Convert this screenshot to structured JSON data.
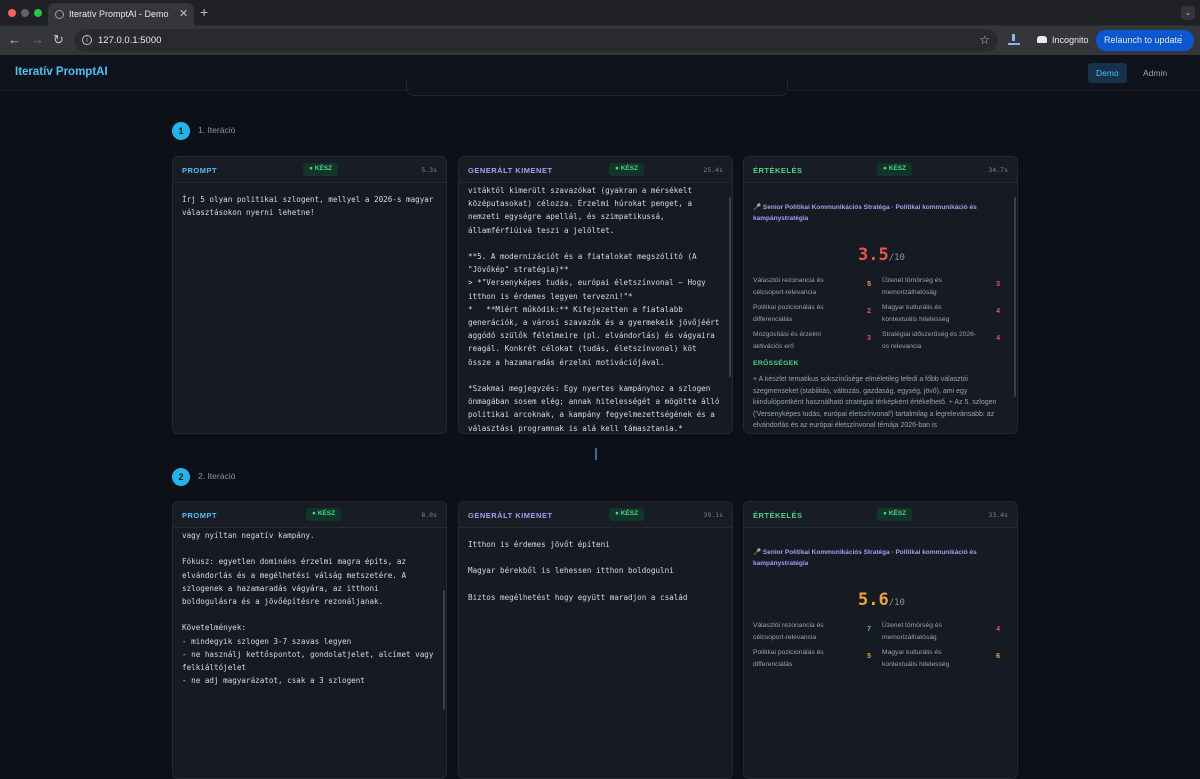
{
  "browser": {
    "tab_title": "Iteratív PromptAI - Demo",
    "url": "127.0.0.1:5000",
    "incognito_label": "Incognito",
    "relaunch_label": "Relaunch to update",
    "traffic_colors": [
      "#ff5f57",
      "#5f6368",
      "#28c840"
    ]
  },
  "app": {
    "brand": "Iteratív PromptAI",
    "nav": [
      {
        "label": "Demo",
        "active": true
      },
      {
        "label": "Admin",
        "active": false
      }
    ],
    "accent_color": "#4cc3f5"
  },
  "iterations": [
    {
      "number": "1",
      "label": "1. Iteráció",
      "prompt": {
        "title": "PROMPT",
        "status": "● KÉSZ",
        "duration": "5.3s",
        "text": "Írj 5 olyan politikai szlogent, mellyel a 2026-s magyar választásokon nyerni lehetne!"
      },
      "output": {
        "title": "GENERÁLT KIMENET",
        "status": "● KÉSZ",
        "duration": "25.4s",
        "text": "vitáktól kimerült szavazókat (gyakran a mérsékelt középutasokat) célozza. Érzelmi húrokat penget, a nemzeti egységre apellál, és szimpatikussá, államférfiúivá teszi a jelöltet.\n\n**5. A modernizációt és a fiatalokat megszólító (A \"Jövőkép\" stratégia)**\n> *\"Versenyképes tudás, európai életszínvonal – Hogy itthon is érdemes legyen tervezni!\"*\n*   **Miért működik:** Kifejezetten a fiatalabb generációk, a városi szavazók és a gyermekeik jövőjéért aggódó szülők félelmeire (pl. elvándorlás) és vágyaira reagál. Konkrét célokat (tudás, életszínvonal) köt össze a hazamaradás érzelmi motivációjával.\n\n*Szakmai megjegyzés: Egy nyertes kampányhoz a szlogen önmagában sosem elég; annak hitelességét a mögötte álló politikai arcoknak, a kampány fegyelmezettségének és a választási programnak is alá kell támasztania.*"
      },
      "evaluation": {
        "title": "ÉRTÉKELÉS",
        "status": "● KÉSZ",
        "duration": "34.7s",
        "role": "🎤 Senior Politikai Kommunikációs Stratéga · Politikai kommunikáció és kampánystratégia",
        "score": "3.5",
        "score_max": "/10",
        "score_color": "#f0504f",
        "metrics": [
          {
            "label": "Választói rezonancia és célcsoport-relevancia",
            "value": "5",
            "color": "#f0a33b"
          },
          {
            "label": "Üzenet tömörség és memorizálhatóság",
            "value": "3",
            "color": "#f0504f"
          },
          {
            "label": "Politikai pozicionálás és differenciálás",
            "value": "2",
            "color": "#f0504f"
          },
          {
            "label": "Magyar kulturális és kontextuális hitelesség",
            "value": "4",
            "color": "#f0504f"
          },
          {
            "label": "Mozgósítási és érzelmi aktivációs erő",
            "value": "3",
            "color": "#f0504f"
          },
          {
            "label": "Stratégiai időszerűség és 2026-os relevancia",
            "value": "4",
            "color": "#f0504f"
          }
        ],
        "strengths_title": "ERŐSSÉGEK",
        "strengths": "+ A készlet tematikus sokszínűsége elméletileg lefedi a főbb választói szegmenseket (stabilitás, változás, gazdaság, egység, jövő), ami egy kiindulópontként használható stratégiai térképként értékelhető.\n+ Az 5. szlogen ('Versenyképes tudás, európai életszínvonal') tartalmilag a legrelevánsabb: az elvándorlás és az európai életszínvonal témája 2026-ban is"
      }
    },
    {
      "number": "2",
      "label": "2. Iteráció",
      "prompt": {
        "title": "PROMPT",
        "status": "● KÉSZ",
        "duration": "8.0s",
        "text": "vagy nyíltan negatív kampány.\n\nFókusz: egyetlen domináns érzelmi magra építs, az elvándorlás és a megélhetési válság metszetére. A szlogenek a hazamaradás vágyára, az itthoni boldogulásra és a jövőépítésre rezonáljanak.\n\nKövetelmények:\n- mindegyik szlogen 3-7 szavas legyen\n- ne használj kettőspontot, gondolatjelet, alcímet vagy felkiáltójelet\n- ne adj magyarázatot, csak a 3 szlogent"
      },
      "output": {
        "title": "GENERÁLT KIMENET",
        "status": "● KÉSZ",
        "duration": "39.1s",
        "text": "Itthon is érdemes jövőt építeni\n\nMagyar bérekből is lehessen itthon boldogulni\n\nBiztos megélhetést hogy együtt maradjon a család"
      },
      "evaluation": {
        "title": "ÉRTÉKELÉS",
        "status": "● KÉSZ",
        "duration": "33.4s",
        "role": "🎤 Senior Politikai Kommunikációs Stratéga · Politikai kommunikáció és kampánystratégia",
        "score": "5.6",
        "score_max": "/10",
        "score_color": "#f0a33b",
        "metrics": [
          {
            "label": "Választói rezonancia és célcsoport-relevancia",
            "value": "7",
            "color": "#4ad38a"
          },
          {
            "label": "Üzenet tömörség és memorizálhatóság",
            "value": "4",
            "color": "#f0504f"
          },
          {
            "label": "Politikai pozicionálás és differenciálás",
            "value": "5",
            "color": "#f0a33b"
          },
          {
            "label": "Magyar kulturális és kontextuális hitelesség",
            "value": "6",
            "color": "#f0a33b"
          }
        ]
      }
    }
  ]
}
